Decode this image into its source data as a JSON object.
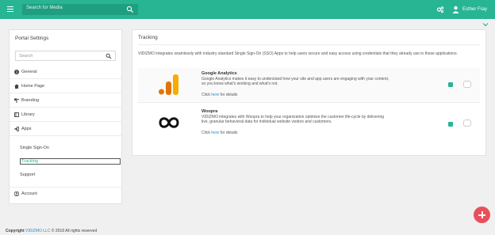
{
  "topbar": {
    "search_placeholder": "Search for Media",
    "user_name": "Esther Fray",
    "icons": [
      "menu-icon",
      "search-icon",
      "tools-icon",
      "user-icon"
    ],
    "accent_color": "#27b594"
  },
  "sidebar": {
    "title": "Portal Settings",
    "search_placeholder": "Search",
    "items": [
      {
        "label": "General",
        "icon": "info-icon"
      },
      {
        "label": "Home Page",
        "icon": "home-icon"
      },
      {
        "label": "Branding",
        "icon": "branding-icon"
      },
      {
        "label": "Library",
        "icon": "library-icon"
      },
      {
        "label": "Apps",
        "icon": "apps-icon"
      }
    ],
    "sub_items": [
      "Single Sign-On",
      "Tracking",
      "Support"
    ],
    "account_label": "Account"
  },
  "main": {
    "title": "Tracking",
    "description": "VIDIZMO integrates seamlessly with industry standard Single Sign-On (SSO) Apps to help users secure and easy access using credentials that they already use in those applications.",
    "integrations": [
      {
        "name": "Google Analytics",
        "text": "Google Analytics makes it easy to understand how your site and app users are engaging with your content, so you know what's working and what's not.",
        "link_prefix": "Click ",
        "link_text": "here",
        "link_suffix": " for details",
        "logo": "google-analytics-logo"
      },
      {
        "name": "Woopra",
        "text": "VIDIZMO integrates with Woopra to help your organization optimize the customer life-cycle by delivering live, granular behavioral data for individual website visitors and customers.",
        "link_prefix": "Click ",
        "link_text": "here",
        "link_suffix": " for details",
        "logo": "woopra-logo"
      }
    ]
  },
  "footer": {
    "copyright_label": "Copyright",
    "brand": "VIDIZMO LLC",
    "rest": "© 2018 All rights reserved"
  }
}
